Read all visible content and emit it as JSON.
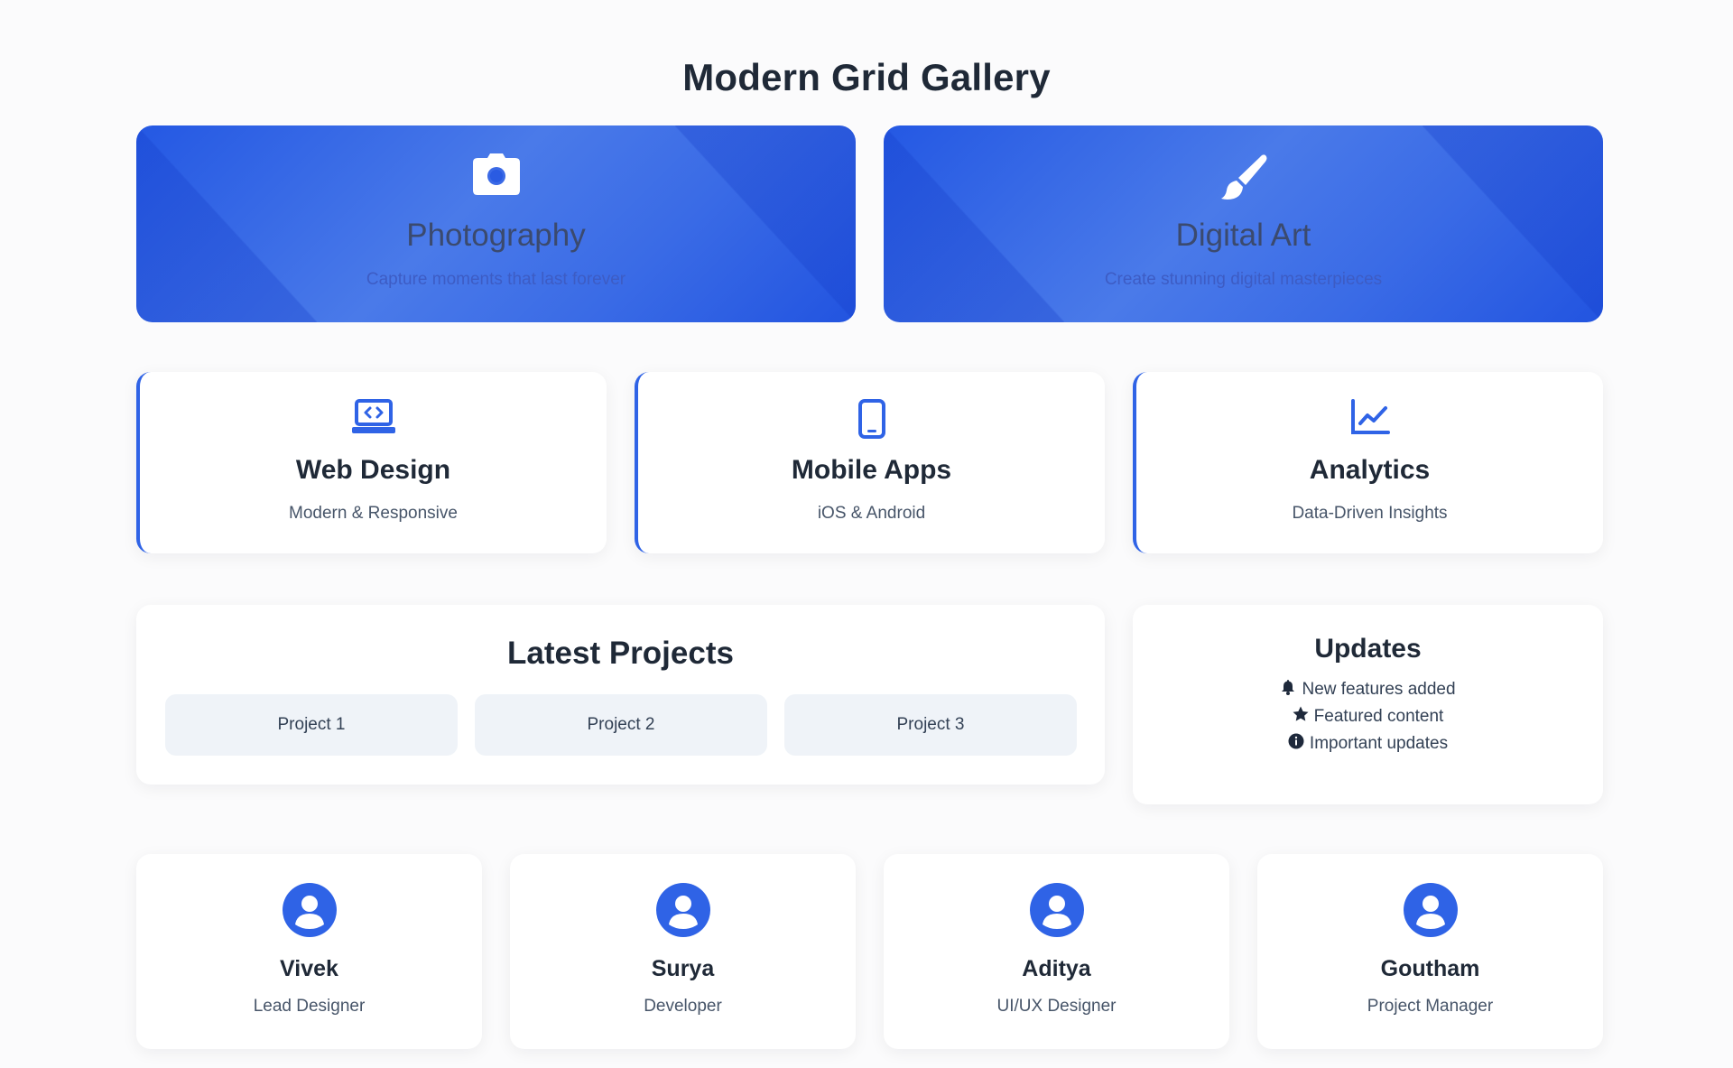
{
  "page": {
    "title": "Modern Grid Gallery"
  },
  "colors": {
    "accent": "#2f63e6",
    "hero_gradient_start": "#2458e3",
    "hero_gradient_mid": "#4a7ae9",
    "card_bg": "#ffffff",
    "project_bg": "#eff3f8"
  },
  "hero": [
    {
      "icon": "camera-icon",
      "title": "Photography",
      "subtitle": "Capture moments that last forever"
    },
    {
      "icon": "paintbrush-icon",
      "title": "Digital Art",
      "subtitle": "Create stunning digital masterpieces"
    }
  ],
  "services": [
    {
      "icon": "laptop-code-icon",
      "title": "Web Design",
      "subtitle": "Modern & Responsive"
    },
    {
      "icon": "mobile-icon",
      "title": "Mobile Apps",
      "subtitle": "iOS & Android"
    },
    {
      "icon": "chart-line-icon",
      "title": "Analytics",
      "subtitle": "Data-Driven Insights"
    }
  ],
  "projects": {
    "title": "Latest Projects",
    "items": [
      "Project 1",
      "Project 2",
      "Project 3"
    ]
  },
  "updates": {
    "title": "Updates",
    "items": [
      {
        "icon": "bell-icon",
        "text": "New features added"
      },
      {
        "icon": "star-icon",
        "text": "Featured content"
      },
      {
        "icon": "info-circle-icon",
        "text": "Important updates"
      }
    ]
  },
  "team": [
    {
      "icon": "user-circle-icon",
      "name": "Vivek",
      "role": "Lead Designer"
    },
    {
      "icon": "user-circle-icon",
      "name": "Surya",
      "role": "Developer"
    },
    {
      "icon": "user-circle-icon",
      "name": "Aditya",
      "role": "UI/UX Designer"
    },
    {
      "icon": "user-circle-icon",
      "name": "Goutham",
      "role": "Project Manager"
    }
  ]
}
